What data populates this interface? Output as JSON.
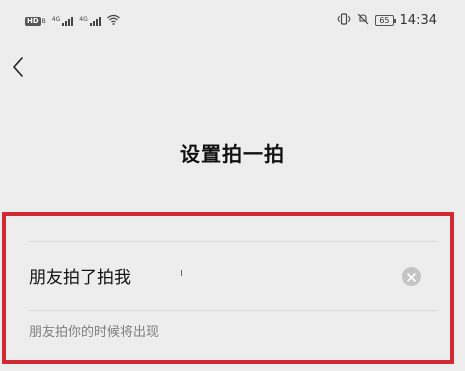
{
  "status_bar": {
    "left_badge": "HD",
    "left_badge_sub": "B",
    "signal_label_1": "4G",
    "signal_label_2": "4G",
    "battery": "65",
    "time": "14:34"
  },
  "nav": {
    "back_icon": "chevron-left-icon"
  },
  "page": {
    "title": "设置拍一拍"
  },
  "form": {
    "input_value": "朋友拍了拍我",
    "clear_icon": "clear-circle-icon",
    "hint": "朋友拍你的时候将出现"
  },
  "colors": {
    "background": "#ededed",
    "highlight_border": "#d12a33",
    "hint_text": "#7f7f7f",
    "clear_button": "#c4c4c4"
  }
}
